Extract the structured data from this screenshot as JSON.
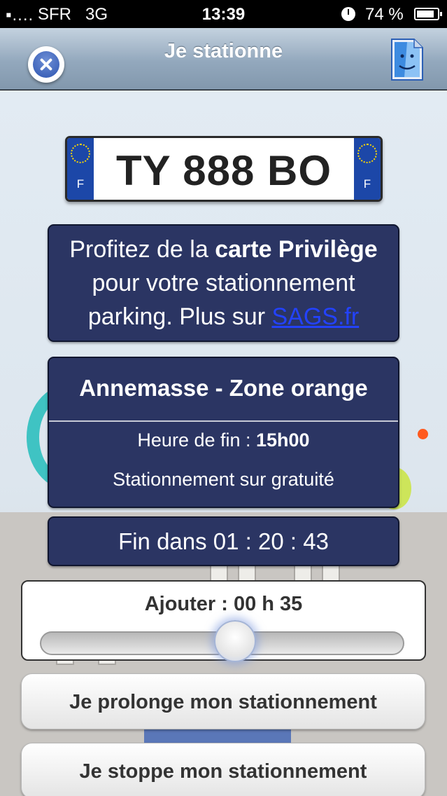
{
  "status_bar": {
    "signal": "▪....",
    "carrier": "SFR",
    "network": "3G",
    "time": "13:39",
    "battery": "74 %"
  },
  "nav": {
    "title": "Je stationne",
    "close_icon": "close-icon",
    "finder_icon": "finder-icon"
  },
  "plate": {
    "number": "TY 888 BO",
    "country_code": "F"
  },
  "promo": {
    "text_before": "Profitez de la ",
    "text_bold": "carte Privilège",
    "text_after": " pour votre stationnement parking. Plus sur ",
    "link": "SAGS.fr"
  },
  "zone": {
    "name": "Annemasse - Zone orange",
    "end_label": "Heure de fin : ",
    "end_time": "15h00",
    "status": "Stationnement sur gratuité"
  },
  "countdown": "Fin dans 01 : 20 : 43",
  "add": {
    "label": "Ajouter : 00 h 35",
    "slider_fraction": 0.55
  },
  "buttons": {
    "prolong": "Je prolonge mon stationnement",
    "stop": "Je stoppe mon stationnement"
  },
  "colors": {
    "panel": "#2b3563",
    "link": "#2342ff",
    "accent_ring": "#3fc3c3"
  }
}
